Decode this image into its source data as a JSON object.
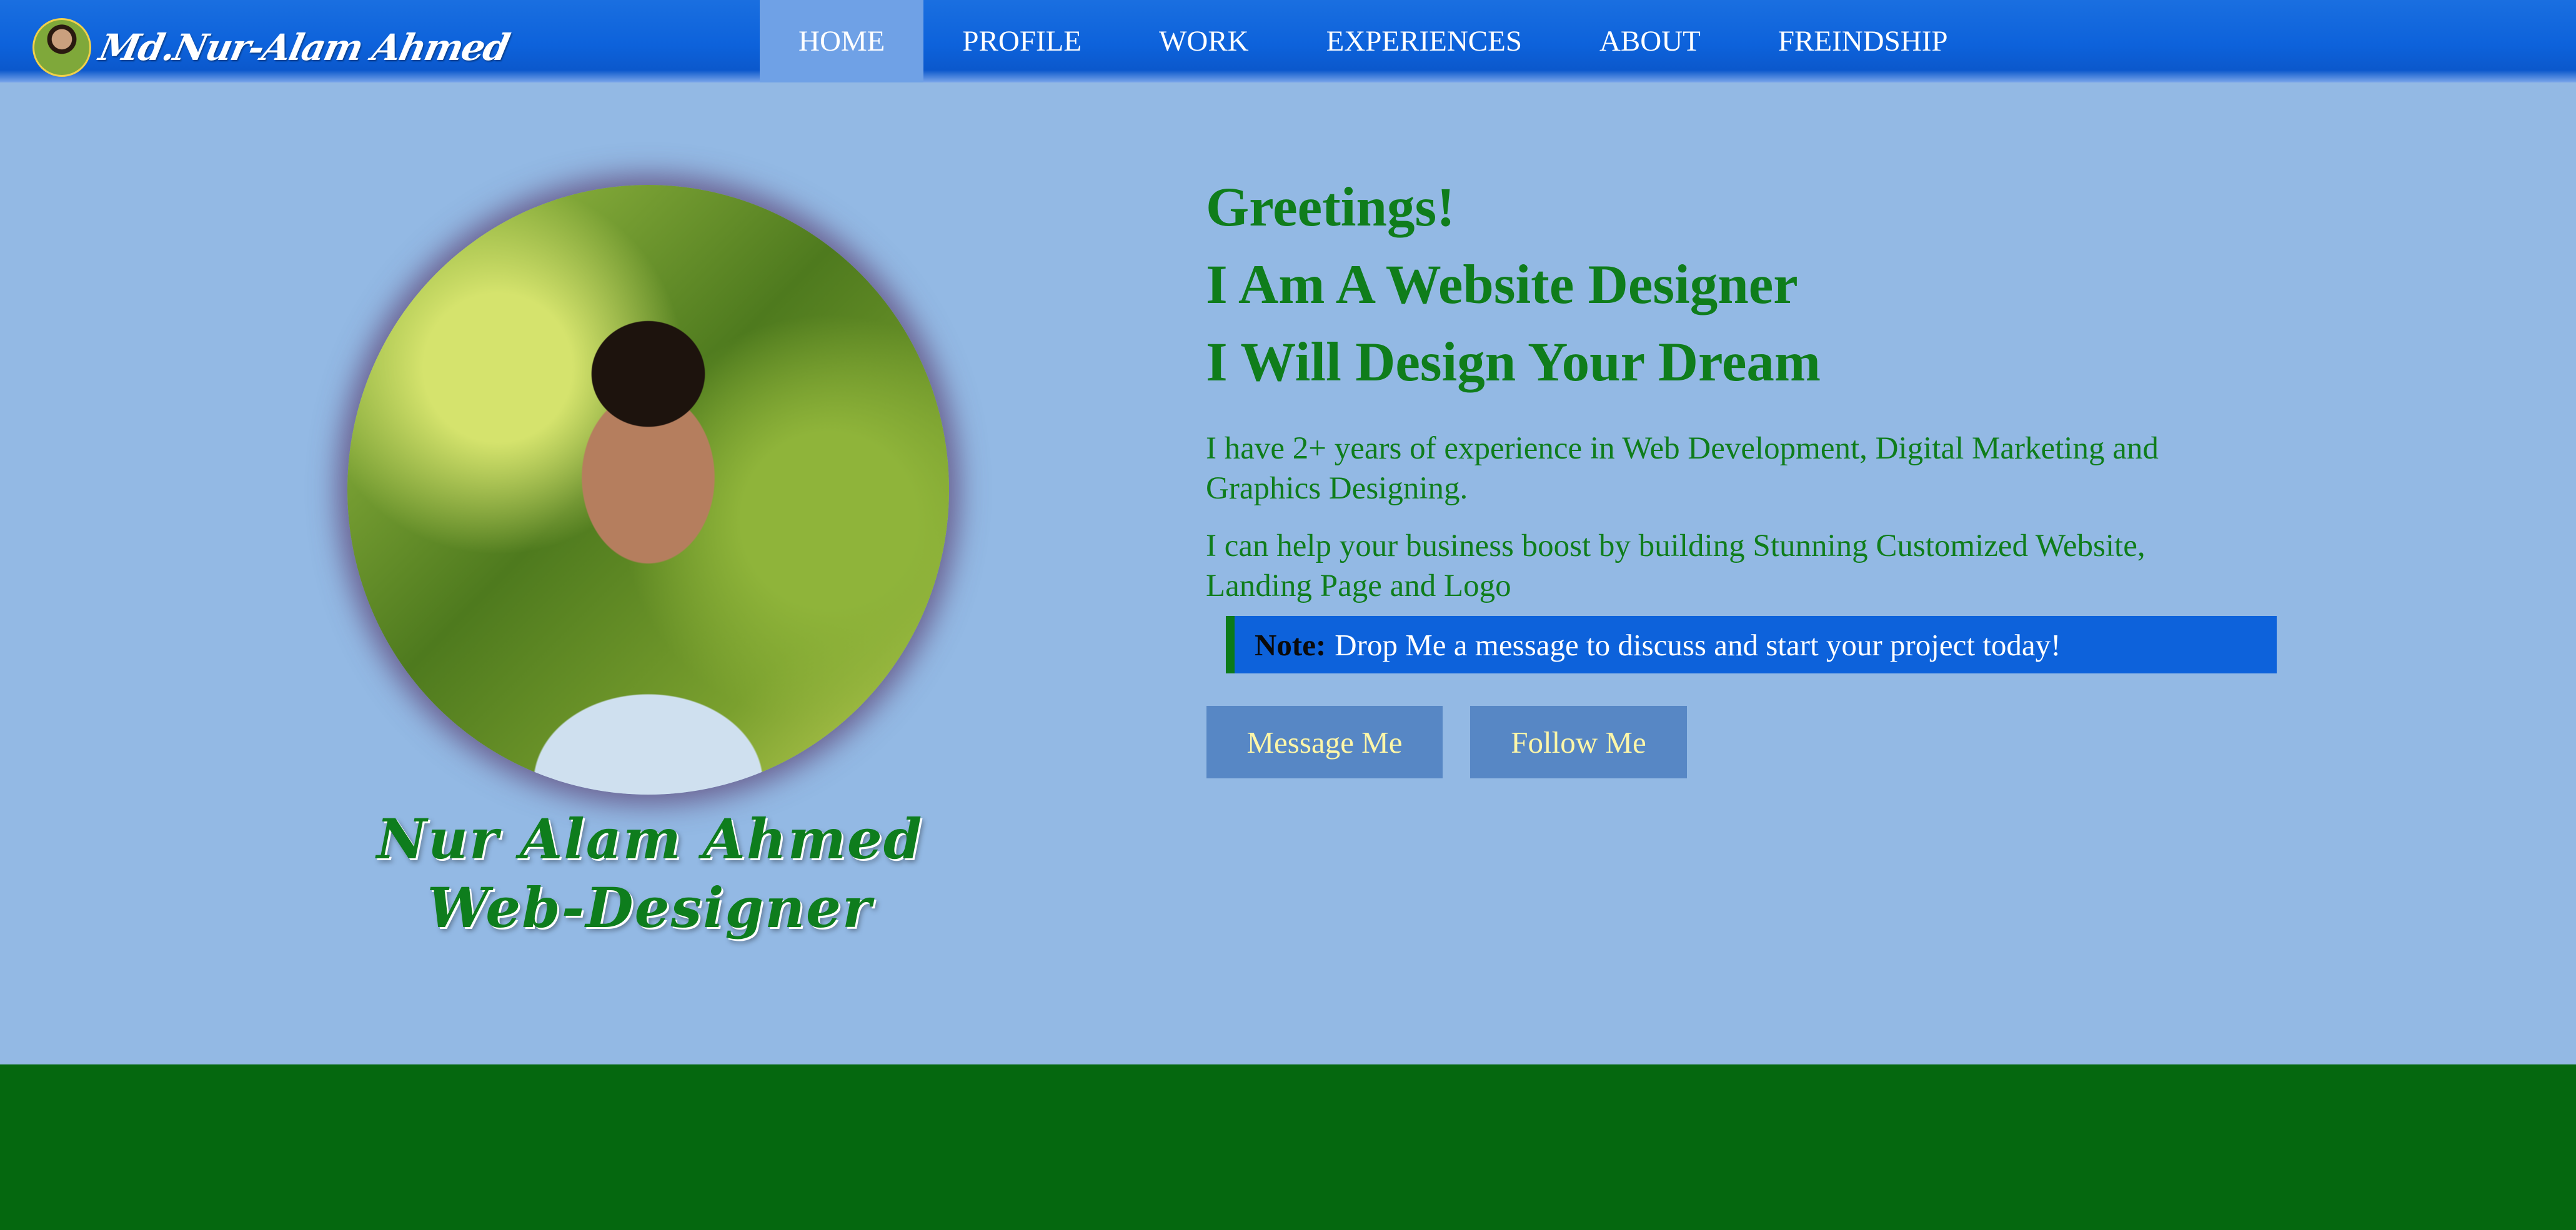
{
  "brand": {
    "name": "Md.Nur-Alam Ahmed",
    "logo_icon": "profile-avatar"
  },
  "nav": {
    "items": [
      {
        "label": "HOME",
        "active": true
      },
      {
        "label": "PROFILE",
        "active": false
      },
      {
        "label": "WORK",
        "active": false
      },
      {
        "label": "EXPERIENCES",
        "active": false
      },
      {
        "label": "ABOUT",
        "active": false
      },
      {
        "label": "FREINDSHIP",
        "active": false
      }
    ]
  },
  "profile": {
    "caption_line1": "Nur Alam Ahmed",
    "caption_line2": "Web-Designer"
  },
  "hero": {
    "line1": "Greetings!",
    "line2": "I Am A Website Designer",
    "line3": "I Will Design Your Dream",
    "para1": "I have 2+ years of experience in Web Development, Digital Marketing and Graphics Designing.",
    "para2": "I can help your business boost by building Stunning Customized Website, Landing Page and Logo"
  },
  "note": {
    "label": "Note:",
    "text": "Drop Me a message to discuss and start your project today!"
  },
  "buttons": {
    "message": "Message Me",
    "follow": "Follow Me"
  },
  "colors": {
    "nav_bg": "#0d62db",
    "nav_active": "#6fa1e6",
    "page_bg": "#93b9e4",
    "accent_green": "#0f7d1b",
    "note_bg": "#0d62db",
    "button_bg": "#5787c5",
    "button_text": "#fdf6a8",
    "footer_bg": "#05680f"
  }
}
